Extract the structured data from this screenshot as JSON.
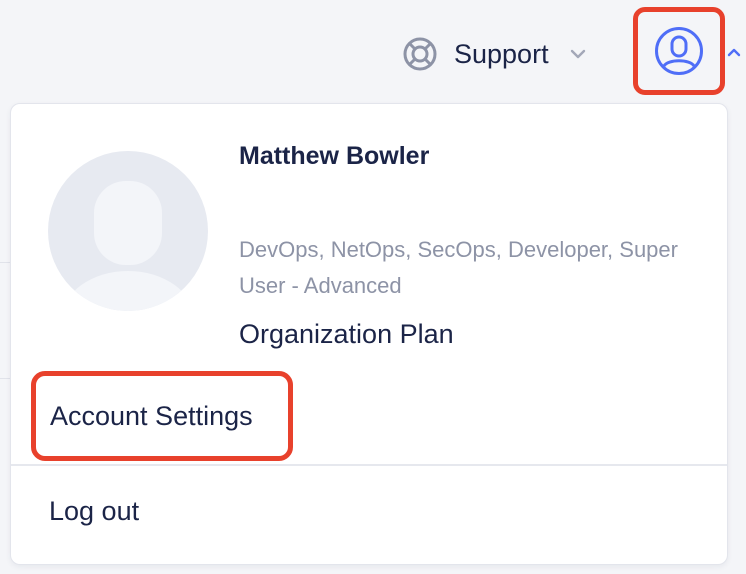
{
  "header": {
    "support_label": "Support",
    "support_icon": "lifebuoy-icon",
    "support_chevron_icon": "chevron-down-icon",
    "user_menu_icon": "user-circle-icon",
    "user_menu_caret_icon": "chevron-up-icon"
  },
  "profile_menu": {
    "name": "Matthew Bowler",
    "roles": "DevOps, NetOps, SecOps, Developer, Super User - Advanced",
    "plan": "Organization Plan",
    "account_settings": "Account Settings",
    "logout": "Log out",
    "avatar_icon": "avatar-placeholder-icon"
  },
  "colors": {
    "highlight": "#e8412c",
    "accent": "#4f6ef7",
    "text": "#1b2447",
    "muted_text": "#8d93a6"
  }
}
